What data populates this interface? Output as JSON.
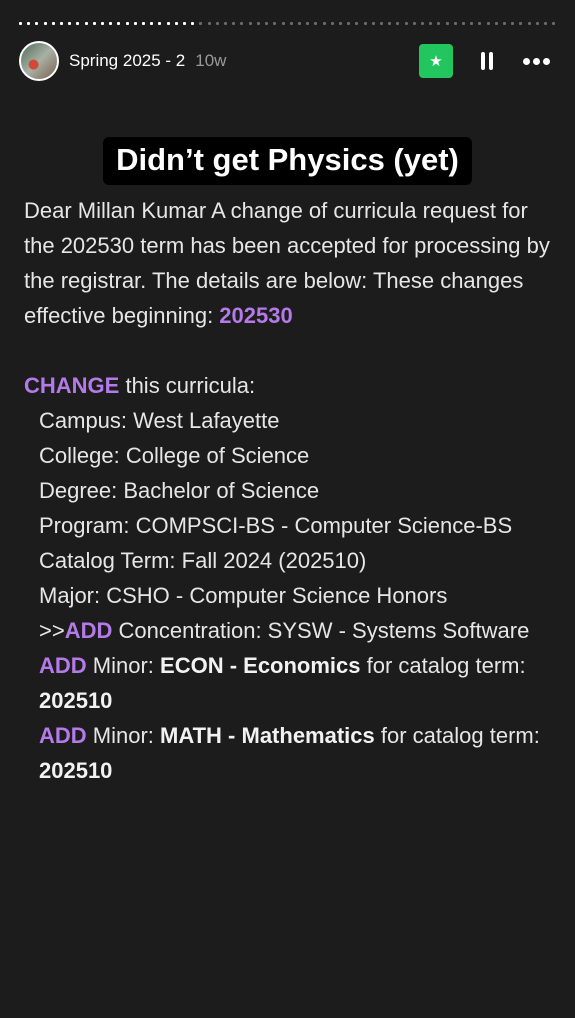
{
  "progress": {
    "segments": 66,
    "viewed": 22
  },
  "header": {
    "title": "Spring 2025 - 2",
    "age": "10w",
    "avatar_icon": "group-photo-avatar",
    "star_icon": "star-icon",
    "pause_icon": "pause-icon",
    "more_icon": "more-icon"
  },
  "headline": "Didn’t get Physics (yet)",
  "colors": {
    "accent": "#b47ae8",
    "star_bg": "#22c55e",
    "background": "#1c1c1c"
  },
  "body": {
    "intro": "Dear Millan Kumar A change of curricula request for the 202530 term has been accepted for processing by the registrar. The details are below: These changes effective beginning: ",
    "effective_term": "202530",
    "change_kw": "CHANGE",
    "change_rest": " this curricula:",
    "campus": "Campus: West Lafayette",
    "college": "College: College of Science",
    "degree": "Degree: Bachelor of Science",
    "program": "Program: COMPSCI-BS - Computer Science-BS",
    "catalog": "Catalog Term: Fall 2024 (202510)",
    "major": "Major: CSHO - Computer Science Honors",
    "conc_prefix": ">>",
    "add_kw": "ADD",
    "conc_rest": " Concentration: SYSW - Systems Software",
    "minor1_pre": " Minor: ",
    "minor1_name": "ECON - Economics",
    "minor_mid": " for catalog term: ",
    "minor1_term": "202510",
    "minor2_name": "MATH - Mathematics",
    "minor2_term": "202510"
  }
}
